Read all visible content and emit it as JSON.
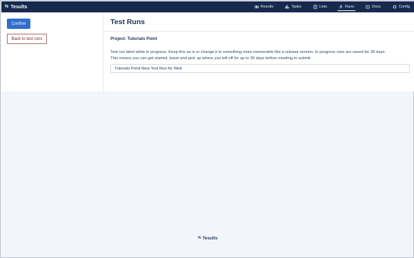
{
  "app": {
    "brand": "Tesults",
    "logo_glyph": "%"
  },
  "nav": {
    "items": [
      {
        "label": "Results",
        "icon": "results-icon"
      },
      {
        "label": "Tasks",
        "icon": "tasks-icon"
      },
      {
        "label": "Lists",
        "icon": "lists-icon"
      },
      {
        "label": "Runs",
        "icon": "runs-icon",
        "active": true
      },
      {
        "label": "Docs",
        "icon": "docs-icon"
      },
      {
        "label": "Config",
        "icon": "config-icon"
      }
    ]
  },
  "sidebar": {
    "confirm_label": "Confirm",
    "back_label": "Back to test runs"
  },
  "main": {
    "title": "Test Runs",
    "project_label": "Project: Tutorials Point",
    "description_line1": "Test run label while in progress. Keep this as is or change it to something more memorable like a release version. In progress runs are saved for 30 days.",
    "description_line2": "This means you can get started, leave and pick up where you left off for up to 30 days before needing to submit.",
    "run_label_value": "Tutorials Point New Test Run for Web"
  },
  "footer": {
    "brand": "Tesults",
    "logo_glyph": "%"
  },
  "colors": {
    "topbar": "#172a4e",
    "confirm_button": "#2f6fcc",
    "back_button_text": "#7a2a2a",
    "page_background": "#f2f5f9"
  }
}
